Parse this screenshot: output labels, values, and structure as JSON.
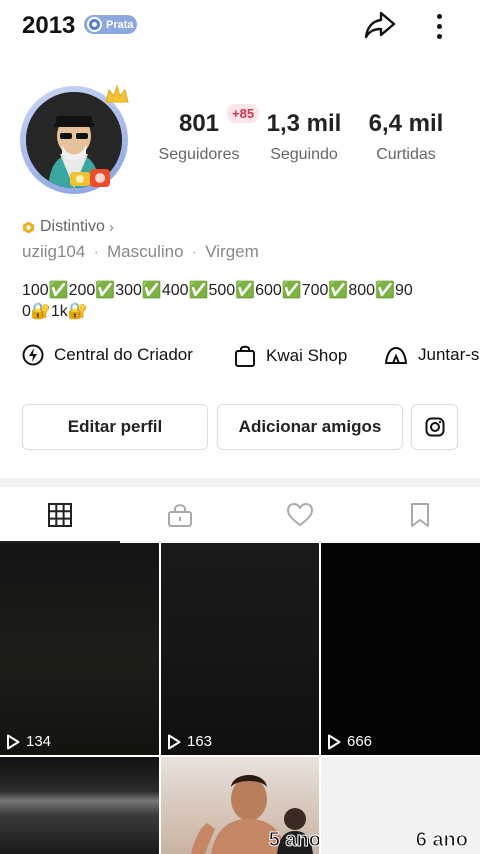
{
  "header": {
    "username": "2013",
    "tier_badge": "Prata",
    "share_icon": "share-arrow-icon",
    "more_icon": "more-vertical-icon"
  },
  "profile": {
    "stats": [
      {
        "value": "801",
        "label": "Seguidores",
        "delta": "+85"
      },
      {
        "value": "1,3 mil",
        "label": "Seguindo"
      },
      {
        "value": "6,4 mil",
        "label": "Curtidas"
      }
    ],
    "badge_label": "Distintivo",
    "badge_chevron": "›",
    "meta": {
      "handle": "uziig104",
      "gender": "Masculino",
      "sign": "Virgem",
      "separator": "·"
    },
    "bio_lines": [
      "100✅200✅300✅400✅500✅600✅700✅800✅90",
      "0🔐1k🔐"
    ]
  },
  "shortcuts": [
    {
      "label": "Central do Criador",
      "icon": "bolt-circle-icon"
    },
    {
      "label": "Kwai Shop",
      "icon": "shopping-bag-icon"
    },
    {
      "label": "Juntar-s",
      "icon": "tent-icon"
    }
  ],
  "actions": {
    "edit_profile": "Editar perfil",
    "add_friends": "Adicionar amigos",
    "instagram_icon": "instagram-icon"
  },
  "tabs": [
    {
      "name": "posts",
      "icon": "grid-icon",
      "active": true
    },
    {
      "name": "private",
      "icon": "lock-icon",
      "active": false
    },
    {
      "name": "liked",
      "icon": "heart-icon",
      "active": false
    },
    {
      "name": "saved",
      "icon": "bookmark-icon",
      "active": false
    }
  ],
  "videos": [
    {
      "plays": "134"
    },
    {
      "plays": "163"
    },
    {
      "plays": "666"
    },
    {
      "plays": ""
    },
    {
      "plays": ""
    },
    {
      "plays": "",
      "overlay_left": "5 ano",
      "overlay_right": "6 ano"
    }
  ],
  "colors": {
    "accent_red": "#d0334c",
    "tier_blue": "#8da7df",
    "badge_gold": "#e8b21f"
  }
}
